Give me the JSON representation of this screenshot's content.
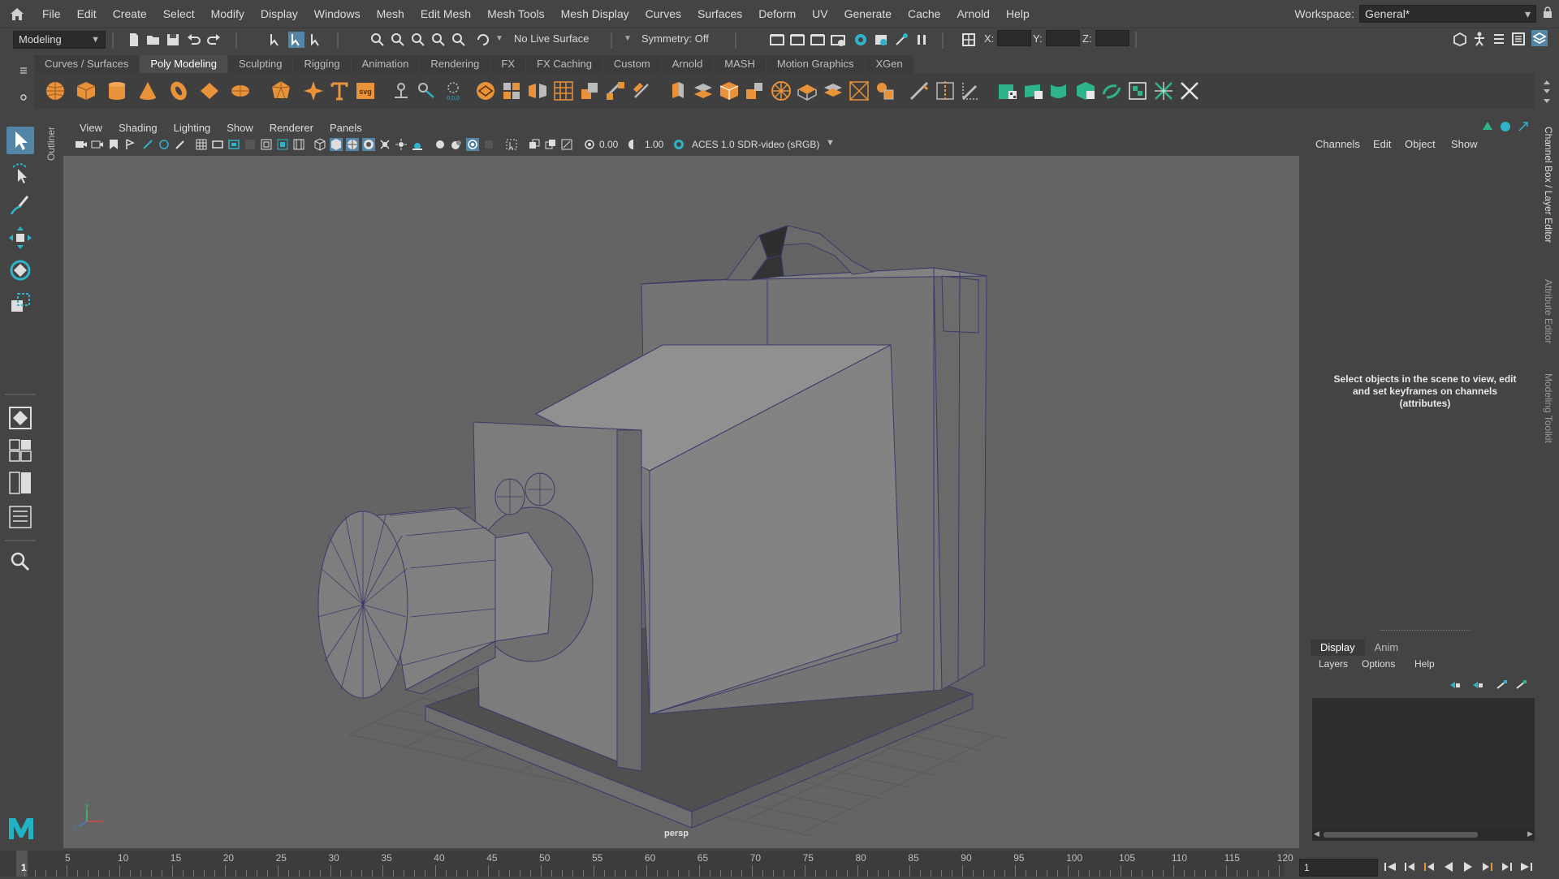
{
  "menubar": {
    "items": [
      "File",
      "Edit",
      "Create",
      "Select",
      "Modify",
      "Display",
      "Windows",
      "Mesh",
      "Edit Mesh",
      "Mesh Tools",
      "Mesh Display",
      "Curves",
      "Surfaces",
      "Deform",
      "UV",
      "Generate",
      "Cache",
      "Arnold",
      "Help"
    ],
    "workspace_label": "Workspace:",
    "workspace_value": "General*"
  },
  "statusline": {
    "mode": "Modeling",
    "live_surface": "No Live Surface",
    "symmetry": "Symmetry: Off",
    "x_label": "X:",
    "y_label": "Y:",
    "z_label": "Z:"
  },
  "shelf": {
    "tabs": [
      "Curves / Surfaces",
      "Poly Modeling",
      "Sculpting",
      "Rigging",
      "Animation",
      "Rendering",
      "FX",
      "FX Caching",
      "Custom",
      "Arnold",
      "MASH",
      "Motion Graphics",
      "XGen"
    ],
    "active_tab": "Poly Modeling",
    "accent_orange": "#e8923a",
    "accent_green": "#2fb38a"
  },
  "outliner_label": "Outliner",
  "panel": {
    "menus": [
      "View",
      "Shading",
      "Lighting",
      "Show",
      "Renderer",
      "Panels"
    ],
    "exposure": "0.00",
    "gamma": "1.00",
    "color_space": "ACES 1.0 SDR-video (sRGB)",
    "camera_label": "persp"
  },
  "channelbox": {
    "menus": [
      "Channels",
      "Edit",
      "Object",
      "Show"
    ],
    "message": "Select objects in the scene to view, edit and set keyframes on channels (attributes)",
    "layer_tabs": [
      "Display",
      "Anim"
    ],
    "layer_active": "Display",
    "layer_menus": [
      "Layers",
      "Options",
      "Help"
    ]
  },
  "righttabs": [
    "Channel Box / Layer Editor",
    "Attribute Editor",
    "Modeling Toolkit"
  ],
  "timeslider": {
    "labels": [
      "5",
      "10",
      "15",
      "20",
      "25",
      "30",
      "35",
      "40",
      "45",
      "50",
      "55",
      "60",
      "65",
      "70",
      "75",
      "80",
      "85",
      "90",
      "95",
      "100",
      "105",
      "110",
      "115",
      "120"
    ],
    "current_frame": "1",
    "frame_field": "1"
  }
}
